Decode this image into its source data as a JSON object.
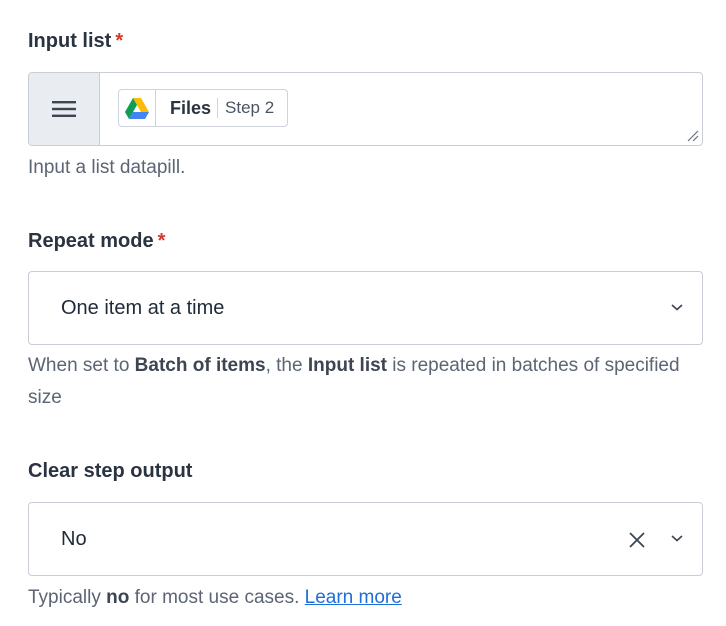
{
  "input_list": {
    "label": "Input list",
    "required_mark": "*",
    "pill": {
      "name": "Files",
      "step": "Step 2",
      "icon": "google-drive-icon"
    },
    "hint": "Input a list datapill."
  },
  "repeat_mode": {
    "label": "Repeat mode",
    "required_mark": "*",
    "value": "One item at a time",
    "hint": {
      "part1": "When set to ",
      "bold1": "Batch of items",
      "part2": ", the ",
      "bold2": "Input list",
      "part3": " is repeated in batches of specified size"
    }
  },
  "clear_step_output": {
    "label": "Clear step output",
    "value": "No",
    "hint": {
      "part1": "Typically ",
      "bold1": "no",
      "part2": " for most use cases. ",
      "link": "Learn more"
    }
  },
  "colors": {
    "required": "#d9352b",
    "link": "#1d6fd6",
    "border": "#c9ced6",
    "handle_bg": "#e9ecf1"
  }
}
